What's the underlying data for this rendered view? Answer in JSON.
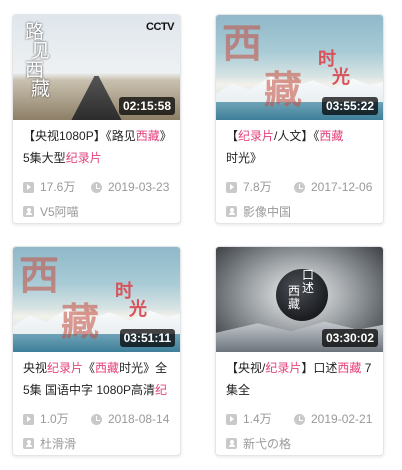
{
  "cards": [
    {
      "title_parts": [
        "【央视1080P】《路见",
        "西藏",
        "》5集大型",
        "纪录片",
        ""
      ],
      "duration": "02:15:58",
      "views": "17.6万",
      "date": "2019-03-23",
      "author": "V5阿喵",
      "thumb_text": {
        "cctv": "CCTV",
        "calligraphy": [
          "路",
          "见",
          "西",
          "藏"
        ]
      }
    },
    {
      "title_parts": [
        "【",
        "纪录片",
        "/人文】《",
        "西藏",
        "时光》"
      ],
      "duration": "03:55:22",
      "views": "7.8万",
      "date": "2017-12-06",
      "author": "影像中国",
      "thumb_text": {
        "calligraphy": [
          "西",
          "藏",
          "时",
          "光"
        ]
      }
    },
    {
      "title_parts": [
        "央视",
        "纪录片",
        "《",
        "西藏",
        "时光》全5集 国语中字 1080P高清",
        "纪",
        ""
      ],
      "duration": "03:51:11",
      "views": "1.0万",
      "date": "2018-08-14",
      "author": "杜滑滑",
      "thumb_text": {
        "calligraphy": [
          "西",
          "藏",
          "时",
          "光"
        ]
      }
    },
    {
      "title_parts": [
        "【央视/",
        "纪录片",
        "】口述",
        "西藏",
        " 7集全"
      ],
      "duration": "03:30:02",
      "views": "1.4万",
      "date": "2019-02-21",
      "author": "新弋の格",
      "thumb_text": {
        "calligraphy": [
          "口",
          "述",
          "西",
          "藏"
        ]
      }
    }
  ],
  "colors": {
    "highlight": "#e4427c",
    "meta": "#999999"
  },
  "icons": {
    "views": "play-icon",
    "date": "clock-icon",
    "author": "user-icon"
  }
}
